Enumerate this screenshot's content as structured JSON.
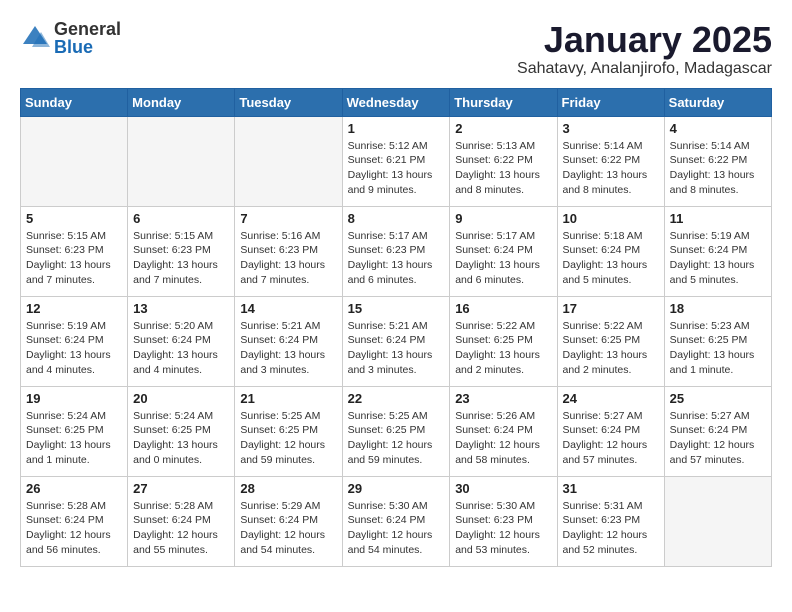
{
  "logo": {
    "general": "General",
    "blue": "Blue"
  },
  "title": "January 2025",
  "subtitle": "Sahatavy, Analanjirofo, Madagascar",
  "days_of_week": [
    "Sunday",
    "Monday",
    "Tuesday",
    "Wednesday",
    "Thursday",
    "Friday",
    "Saturday"
  ],
  "weeks": [
    [
      {
        "day": "",
        "info": ""
      },
      {
        "day": "",
        "info": ""
      },
      {
        "day": "",
        "info": ""
      },
      {
        "day": "1",
        "info": "Sunrise: 5:12 AM\nSunset: 6:21 PM\nDaylight: 13 hours and 9 minutes."
      },
      {
        "day": "2",
        "info": "Sunrise: 5:13 AM\nSunset: 6:22 PM\nDaylight: 13 hours and 8 minutes."
      },
      {
        "day": "3",
        "info": "Sunrise: 5:14 AM\nSunset: 6:22 PM\nDaylight: 13 hours and 8 minutes."
      },
      {
        "day": "4",
        "info": "Sunrise: 5:14 AM\nSunset: 6:22 PM\nDaylight: 13 hours and 8 minutes."
      }
    ],
    [
      {
        "day": "5",
        "info": "Sunrise: 5:15 AM\nSunset: 6:23 PM\nDaylight: 13 hours and 7 minutes."
      },
      {
        "day": "6",
        "info": "Sunrise: 5:15 AM\nSunset: 6:23 PM\nDaylight: 13 hours and 7 minutes."
      },
      {
        "day": "7",
        "info": "Sunrise: 5:16 AM\nSunset: 6:23 PM\nDaylight: 13 hours and 7 minutes."
      },
      {
        "day": "8",
        "info": "Sunrise: 5:17 AM\nSunset: 6:23 PM\nDaylight: 13 hours and 6 minutes."
      },
      {
        "day": "9",
        "info": "Sunrise: 5:17 AM\nSunset: 6:24 PM\nDaylight: 13 hours and 6 minutes."
      },
      {
        "day": "10",
        "info": "Sunrise: 5:18 AM\nSunset: 6:24 PM\nDaylight: 13 hours and 5 minutes."
      },
      {
        "day": "11",
        "info": "Sunrise: 5:19 AM\nSunset: 6:24 PM\nDaylight: 13 hours and 5 minutes."
      }
    ],
    [
      {
        "day": "12",
        "info": "Sunrise: 5:19 AM\nSunset: 6:24 PM\nDaylight: 13 hours and 4 minutes."
      },
      {
        "day": "13",
        "info": "Sunrise: 5:20 AM\nSunset: 6:24 PM\nDaylight: 13 hours and 4 minutes."
      },
      {
        "day": "14",
        "info": "Sunrise: 5:21 AM\nSunset: 6:24 PM\nDaylight: 13 hours and 3 minutes."
      },
      {
        "day": "15",
        "info": "Sunrise: 5:21 AM\nSunset: 6:24 PM\nDaylight: 13 hours and 3 minutes."
      },
      {
        "day": "16",
        "info": "Sunrise: 5:22 AM\nSunset: 6:25 PM\nDaylight: 13 hours and 2 minutes."
      },
      {
        "day": "17",
        "info": "Sunrise: 5:22 AM\nSunset: 6:25 PM\nDaylight: 13 hours and 2 minutes."
      },
      {
        "day": "18",
        "info": "Sunrise: 5:23 AM\nSunset: 6:25 PM\nDaylight: 13 hours and 1 minute."
      }
    ],
    [
      {
        "day": "19",
        "info": "Sunrise: 5:24 AM\nSunset: 6:25 PM\nDaylight: 13 hours and 1 minute."
      },
      {
        "day": "20",
        "info": "Sunrise: 5:24 AM\nSunset: 6:25 PM\nDaylight: 13 hours and 0 minutes."
      },
      {
        "day": "21",
        "info": "Sunrise: 5:25 AM\nSunset: 6:25 PM\nDaylight: 12 hours and 59 minutes."
      },
      {
        "day": "22",
        "info": "Sunrise: 5:25 AM\nSunset: 6:25 PM\nDaylight: 12 hours and 59 minutes."
      },
      {
        "day": "23",
        "info": "Sunrise: 5:26 AM\nSunset: 6:24 PM\nDaylight: 12 hours and 58 minutes."
      },
      {
        "day": "24",
        "info": "Sunrise: 5:27 AM\nSunset: 6:24 PM\nDaylight: 12 hours and 57 minutes."
      },
      {
        "day": "25",
        "info": "Sunrise: 5:27 AM\nSunset: 6:24 PM\nDaylight: 12 hours and 57 minutes."
      }
    ],
    [
      {
        "day": "26",
        "info": "Sunrise: 5:28 AM\nSunset: 6:24 PM\nDaylight: 12 hours and 56 minutes."
      },
      {
        "day": "27",
        "info": "Sunrise: 5:28 AM\nSunset: 6:24 PM\nDaylight: 12 hours and 55 minutes."
      },
      {
        "day": "28",
        "info": "Sunrise: 5:29 AM\nSunset: 6:24 PM\nDaylight: 12 hours and 54 minutes."
      },
      {
        "day": "29",
        "info": "Sunrise: 5:30 AM\nSunset: 6:24 PM\nDaylight: 12 hours and 54 minutes."
      },
      {
        "day": "30",
        "info": "Sunrise: 5:30 AM\nSunset: 6:23 PM\nDaylight: 12 hours and 53 minutes."
      },
      {
        "day": "31",
        "info": "Sunrise: 5:31 AM\nSunset: 6:23 PM\nDaylight: 12 hours and 52 minutes."
      },
      {
        "day": "",
        "info": ""
      }
    ]
  ]
}
